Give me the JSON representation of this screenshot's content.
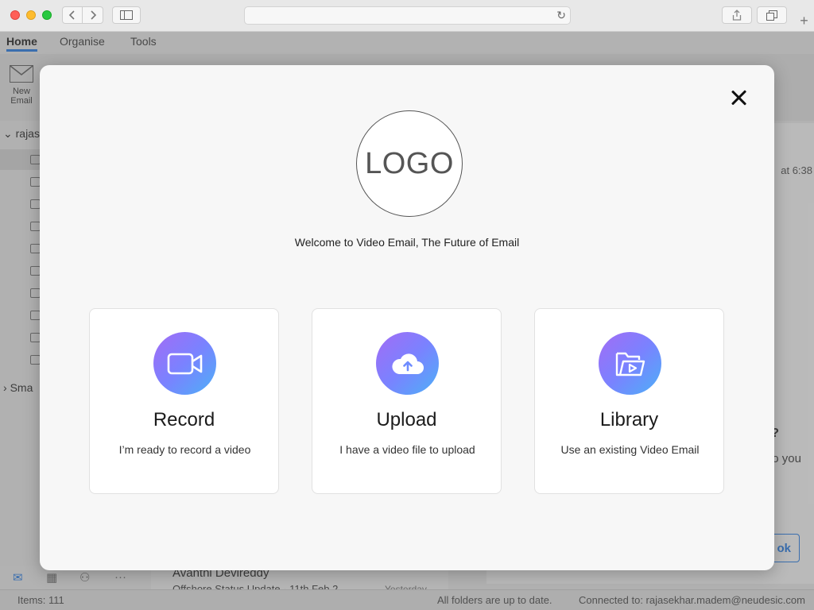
{
  "browser": {
    "back_icon": "chevron-left-icon",
    "forward_icon": "chevron-right-icon",
    "url": "",
    "new_tab_label": "+"
  },
  "outlook": {
    "tabs": [
      {
        "label": "Home"
      },
      {
        "label": "Organise"
      },
      {
        "label": "Tools"
      }
    ],
    "new_email_label": "New\nEmail",
    "account": "rajas",
    "smart_folders": "Sma",
    "message": {
      "sender": "Avanthi Devireddy",
      "subject": "Offshore Status Update - 11th Feb 2",
      "date": "Yesterday"
    },
    "reading_time": "at 6:38",
    "reading_q": "?",
    "reading_you": "o you",
    "reading_btn": "ok",
    "status": {
      "items": "Items: 111",
      "sync": "All folders are up to date.",
      "connected": "Connected to: rajasekhar.madem@neudesic.com"
    }
  },
  "modal": {
    "logo_text": "LOGO",
    "welcome": "Welcome to Video Email, The Future of Email",
    "close_icon": "close-icon",
    "cards": [
      {
        "title": "Record",
        "description": "I’m ready to record a video",
        "icon": "video-camera-icon"
      },
      {
        "title": "Upload",
        "description": "I have a video file to upload",
        "icon": "cloud-upload-icon"
      },
      {
        "title": "Library",
        "description": "Use an existing Video Email",
        "icon": "folder-video-icon"
      }
    ],
    "accent_gradient": [
      "#a36cf5",
      "#7a82ff",
      "#4db0f7"
    ]
  }
}
